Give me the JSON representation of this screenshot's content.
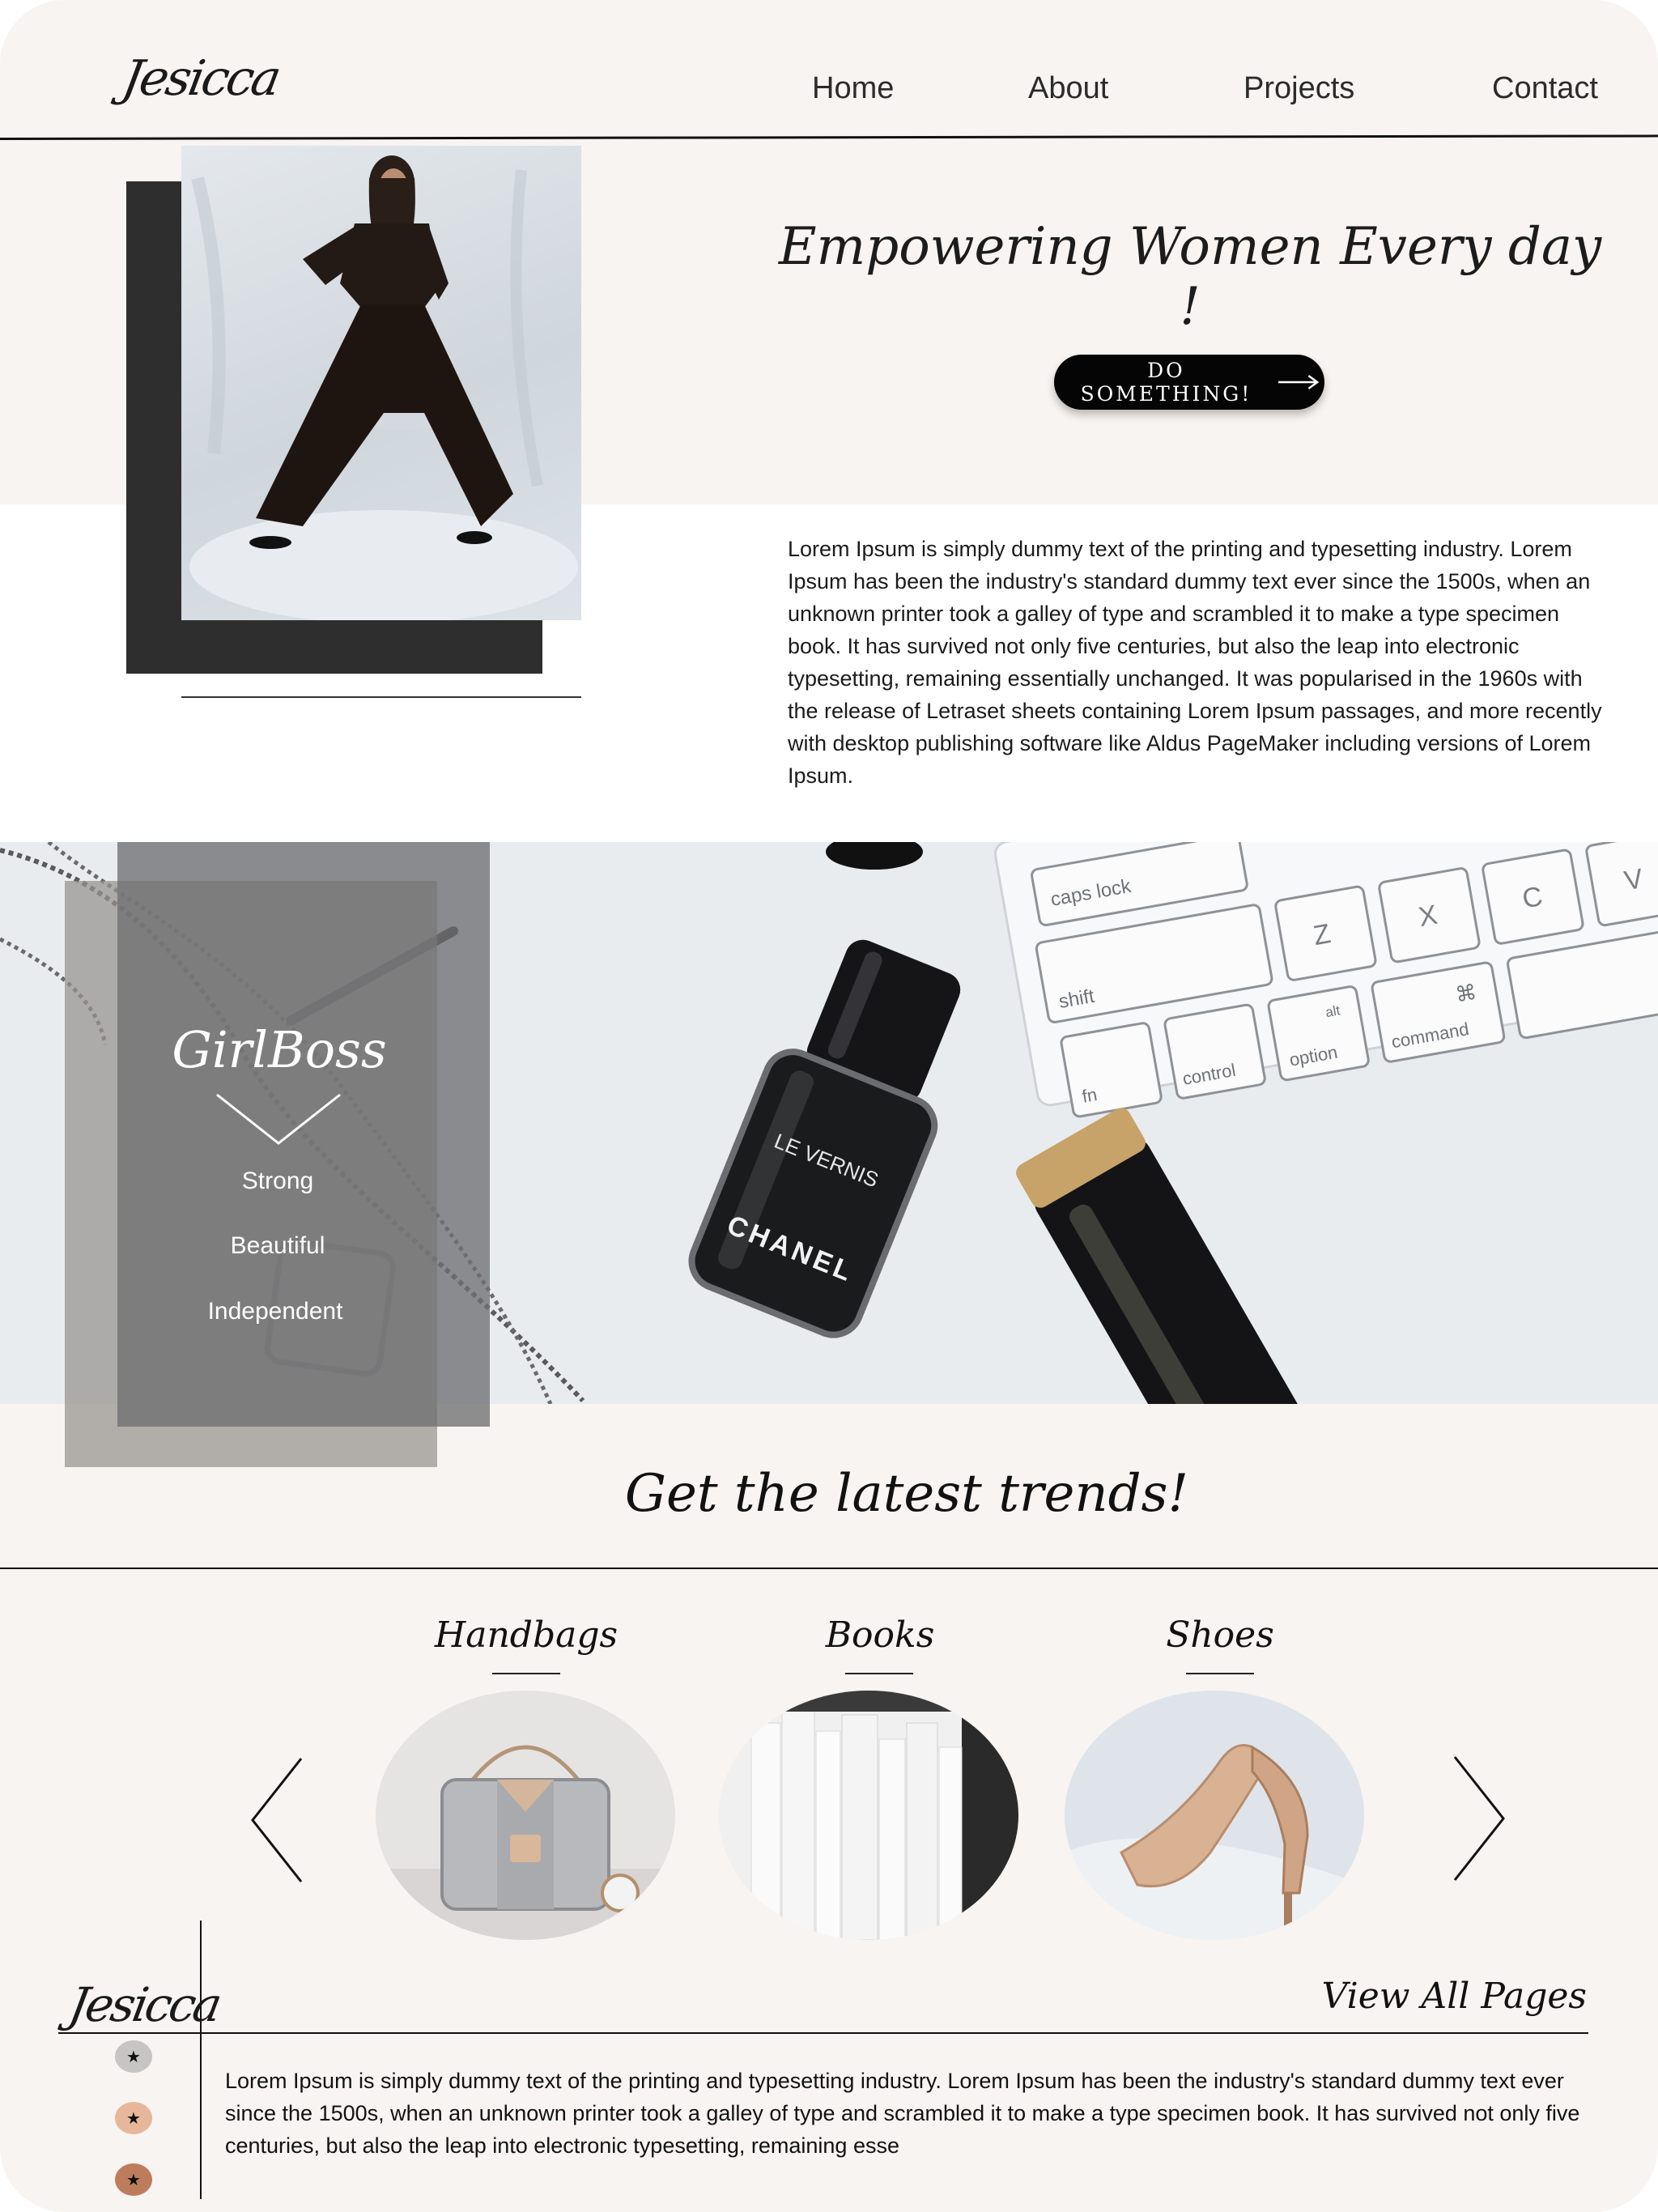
{
  "brand": {
    "logo_text": "Jesicca"
  },
  "nav": {
    "items": [
      "Home",
      "About",
      "Projects",
      "Contact"
    ]
  },
  "hero": {
    "title": "Empowering Women Every day !",
    "cta_label": "DO SOMETHING!",
    "body": "Lorem Ipsum is simply dummy text of the printing and typesetting industry. Lorem Ipsum has been the industry's standard dummy text ever since the 1500s, when an unknown printer took a galley of type and scrambled it to make a type specimen book. It has survived not only five centuries, but also the leap into electronic typesetting, remaining essentially unchanged. It was popularised in the 1960s with the release of Letraset sheets containing Lorem Ipsum passages, and more recently with desktop publishing software like Aldus PageMaker including versions of Lorem Ipsum."
  },
  "banner": {
    "title": "GirlBoss",
    "items": [
      "Strong",
      "Beautiful",
      "Independent"
    ],
    "keyboard_keys": [
      "caps lock",
      "shift",
      "fn",
      "control",
      "option",
      "alt",
      "command",
      "⌘",
      "Z",
      "X",
      "C",
      "V"
    ],
    "bottle_text": [
      "LE VERNIS",
      "CHANEL"
    ]
  },
  "trends": {
    "title": "Get the latest trends!",
    "categories": [
      {
        "label": "Handbags",
        "icon": "handbag-image"
      },
      {
        "label": "Books",
        "icon": "books-image"
      },
      {
        "label": "Shoes",
        "icon": "shoe-image"
      }
    ],
    "prev_icon": "chevron-left-icon",
    "next_icon": "chevron-right-icon"
  },
  "footer": {
    "logo_text": "Jesicca",
    "view_all": "View All Pages",
    "body": "Lorem Ipsum is simply dummy text of the printing and typesetting industry. Lorem Ipsum has been the industry's standard dummy text ever since the 1500s, when an unknown printer took a galley of type and scrambled it to make a type specimen book. It has survived not only five centuries, but also the leap into electronic typesetting, remaining esse",
    "social": [
      {
        "icon": "star-icon",
        "color": "#c7c5c3"
      },
      {
        "icon": "star-icon",
        "color": "#e7b79c"
      },
      {
        "icon": "star-icon",
        "color": "#bd7d5d"
      }
    ],
    "social_glyph": "★"
  },
  "colors": {
    "background": "#f7f4f1",
    "accent_dark": "#050505",
    "panel_grey": "#707072"
  }
}
